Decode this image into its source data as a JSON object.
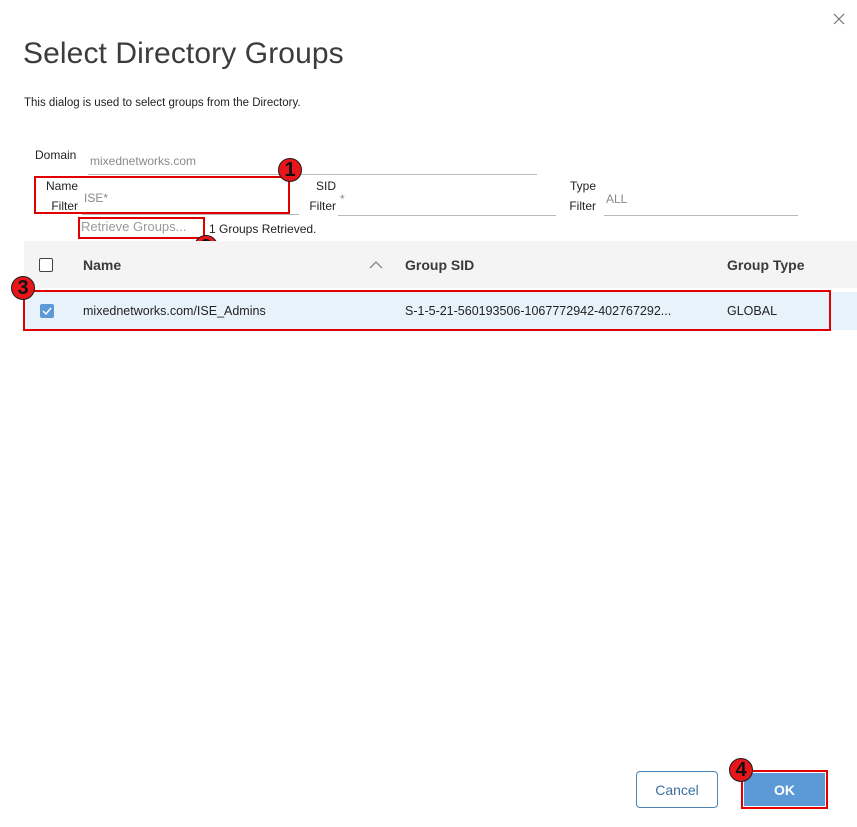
{
  "dialog": {
    "title": "Select Directory Groups",
    "description": "This dialog is used to select groups from the Directory."
  },
  "filters": {
    "domain_label": "Domain",
    "domain_value": "mixednetworks.com",
    "name_label_1": "Name",
    "name_label_2": "Filter",
    "name_value": "ISE*",
    "sid_label_1": "SID",
    "sid_label_2": "Filter",
    "sid_value": "*",
    "type_label_1": "Type",
    "type_label_2": "Filter",
    "type_value": "ALL"
  },
  "actions": {
    "retrieve_label": "Retrieve Groups...",
    "retrieved_status": "1 Groups Retrieved."
  },
  "table": {
    "columns": [
      "Name",
      "Group SID",
      "Group Type"
    ],
    "rows": [
      {
        "checked": true,
        "name": "mixednetworks.com/ISE_Admins",
        "sid": "S-1-5-21-560193506-1067772942-402767292...",
        "type": "GLOBAL"
      }
    ]
  },
  "footer": {
    "cancel_label": "Cancel",
    "ok_label": "OK"
  },
  "annotations": [
    "1",
    "2",
    "3",
    "4"
  ],
  "colors": {
    "accent": "#5b9ad6",
    "annotation_red": "#e8161b",
    "row_selected": "#e8f2fb"
  }
}
